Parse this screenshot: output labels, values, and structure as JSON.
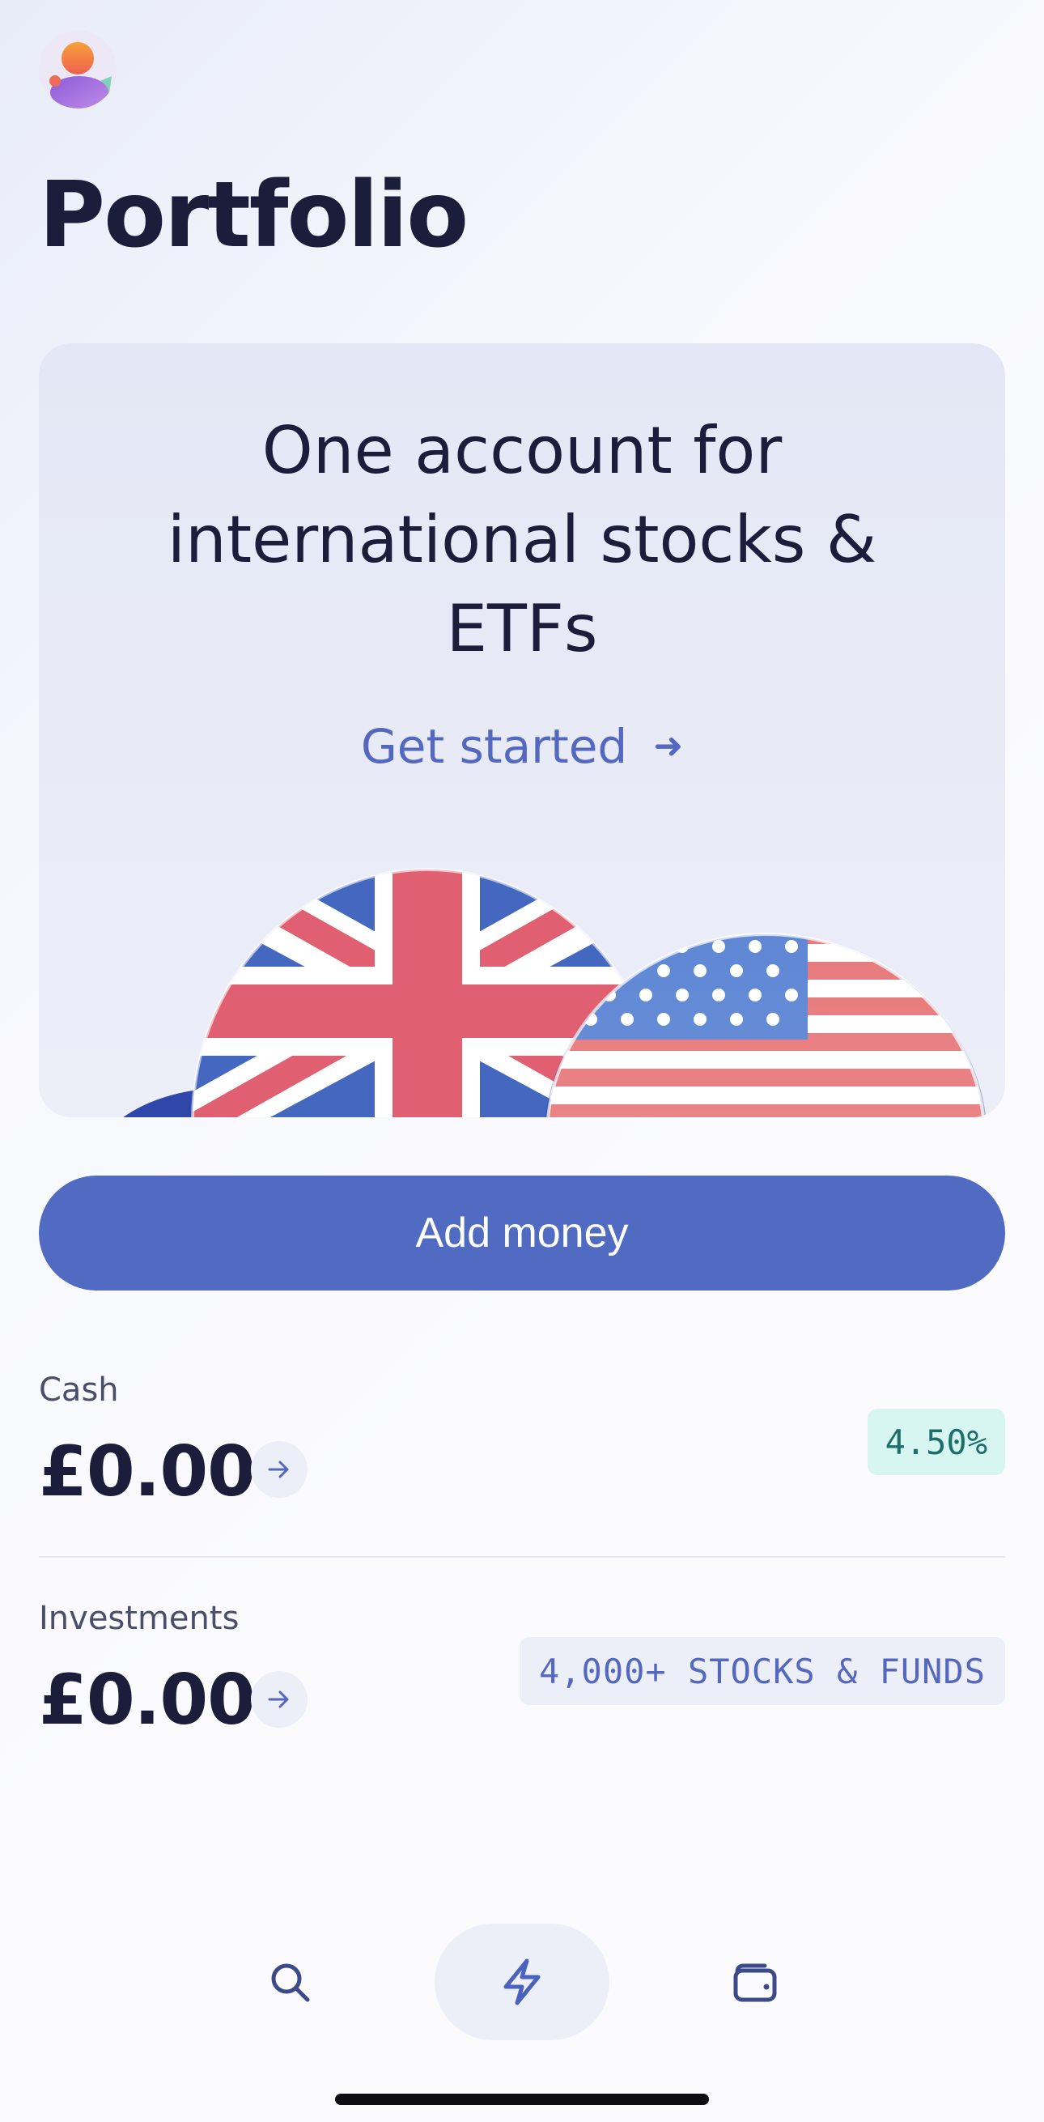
{
  "header": {
    "title": "Portfolio"
  },
  "promo": {
    "headline_lines": [
      "One account for",
      "international stocks &",
      "ETFs"
    ],
    "cta_label": "Get started"
  },
  "actions": {
    "add_money_label": "Add money"
  },
  "cash": {
    "label": "Cash",
    "amount": "£0.00",
    "rate_badge": "4.50%"
  },
  "investments": {
    "label": "Investments",
    "amount": "£0.00",
    "badge": "4,000+ STOCKS & FUNDS"
  },
  "nav": {
    "items": [
      {
        "icon": "search-icon",
        "active": false
      },
      {
        "icon": "lightning-icon",
        "active": true
      },
      {
        "icon": "wallet-icon",
        "active": false
      }
    ]
  },
  "colors": {
    "accent": "#506bc1",
    "rate_badge_bg": "#d8f6f1",
    "title": "#1b1d3a"
  }
}
